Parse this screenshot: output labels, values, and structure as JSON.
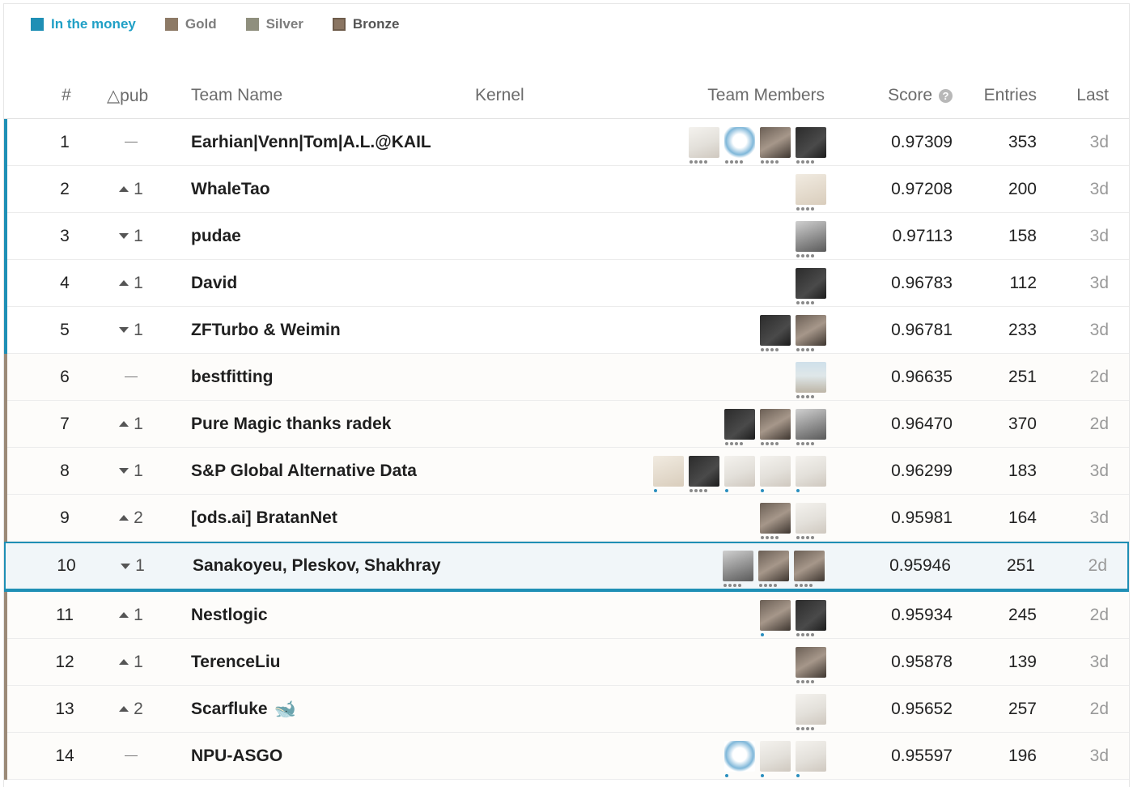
{
  "legend": [
    {
      "label": "In the money",
      "key": "money"
    },
    {
      "label": "Gold",
      "key": "gold"
    },
    {
      "label": "Silver",
      "key": "silver"
    },
    {
      "label": "Bronze",
      "key": "bronze"
    }
  ],
  "columns": {
    "rank": "#",
    "delta": "△pub",
    "team": "Team Name",
    "kernel": "Kernel",
    "members": "Team Members",
    "score": "Score",
    "entries": "Entries",
    "last": "Last"
  },
  "rows": [
    {
      "rank": "1",
      "delta_dir": "none",
      "delta": "",
      "team": "Earhian|Venn|Tom|A.L.@KAIL",
      "members": [
        "goose",
        "owl",
        "photo",
        "dark"
      ],
      "score": "0.97309",
      "entries": "353",
      "last": "3d",
      "tier": "money"
    },
    {
      "rank": "2",
      "delta_dir": "up",
      "delta": "1",
      "team": "WhaleTao",
      "members": [
        "light"
      ],
      "score": "0.97208",
      "entries": "200",
      "last": "3d",
      "tier": "money"
    },
    {
      "rank": "3",
      "delta_dir": "down",
      "delta": "1",
      "team": "pudae",
      "members": [
        "bw"
      ],
      "score": "0.97113",
      "entries": "158",
      "last": "3d",
      "tier": "money"
    },
    {
      "rank": "4",
      "delta_dir": "up",
      "delta": "1",
      "team": "David",
      "members": [
        "dark"
      ],
      "score": "0.96783",
      "entries": "112",
      "last": "3d",
      "tier": "money"
    },
    {
      "rank": "5",
      "delta_dir": "down",
      "delta": "1",
      "team": "ZFTurbo & Weimin",
      "members": [
        "dark",
        "photo"
      ],
      "score": "0.96781",
      "entries": "233",
      "last": "3d",
      "tier": "money"
    },
    {
      "rank": "6",
      "delta_dir": "none",
      "delta": "",
      "team": "bestfitting",
      "members": [
        "beach"
      ],
      "score": "0.96635",
      "entries": "251",
      "last": "2d",
      "tier": "gold"
    },
    {
      "rank": "7",
      "delta_dir": "up",
      "delta": "1",
      "team": "Pure Magic thanks radek",
      "members": [
        "dark",
        "photo",
        "bw"
      ],
      "score": "0.96470",
      "entries": "370",
      "last": "2d",
      "tier": "gold"
    },
    {
      "rank": "8",
      "delta_dir": "down",
      "delta": "1",
      "team": "S&P Global Alternative Data",
      "members": [
        "light",
        "dark",
        "goose",
        "goose",
        "goose"
      ],
      "score": "0.96299",
      "entries": "183",
      "last": "3d",
      "tier": "gold"
    },
    {
      "rank": "9",
      "delta_dir": "up",
      "delta": "2",
      "team": "[ods.ai] BratanNet",
      "members": [
        "photo",
        "goose"
      ],
      "score": "0.95981",
      "entries": "164",
      "last": "3d",
      "tier": "gold"
    },
    {
      "rank": "10",
      "delta_dir": "down",
      "delta": "1",
      "team": "Sanakoyeu, Pleskov, Shakhray",
      "members": [
        "bw",
        "photo",
        "photo"
      ],
      "score": "0.95946",
      "entries": "251",
      "last": "2d",
      "tier": "selected"
    },
    {
      "rank": "11",
      "delta_dir": "up",
      "delta": "1",
      "team": "Nestlogic",
      "members": [
        "photo",
        "dark"
      ],
      "score": "0.95934",
      "entries": "245",
      "last": "2d",
      "tier": "gold"
    },
    {
      "rank": "12",
      "delta_dir": "up",
      "delta": "1",
      "team": "TerenceLiu",
      "members": [
        "photo"
      ],
      "score": "0.95878",
      "entries": "139",
      "last": "3d",
      "tier": "gold"
    },
    {
      "rank": "13",
      "delta_dir": "up",
      "delta": "2",
      "team": "Scarfluke",
      "members": [
        "goose"
      ],
      "score": "0.95652",
      "entries": "257",
      "last": "2d",
      "tier": "gold",
      "badge": "whale-icon"
    },
    {
      "rank": "14",
      "delta_dir": "none",
      "delta": "",
      "team": "NPU-ASGO",
      "members": [
        "owl",
        "goose",
        "goose"
      ],
      "score": "0.95597",
      "entries": "196",
      "last": "3d",
      "tier": "gold"
    }
  ],
  "colors": {
    "money": "#1f8fb5",
    "gold": "#8d7a66",
    "silver": "#8f8f7e",
    "bronze": "#8a7562",
    "selected_border": "#1f8fb5"
  }
}
